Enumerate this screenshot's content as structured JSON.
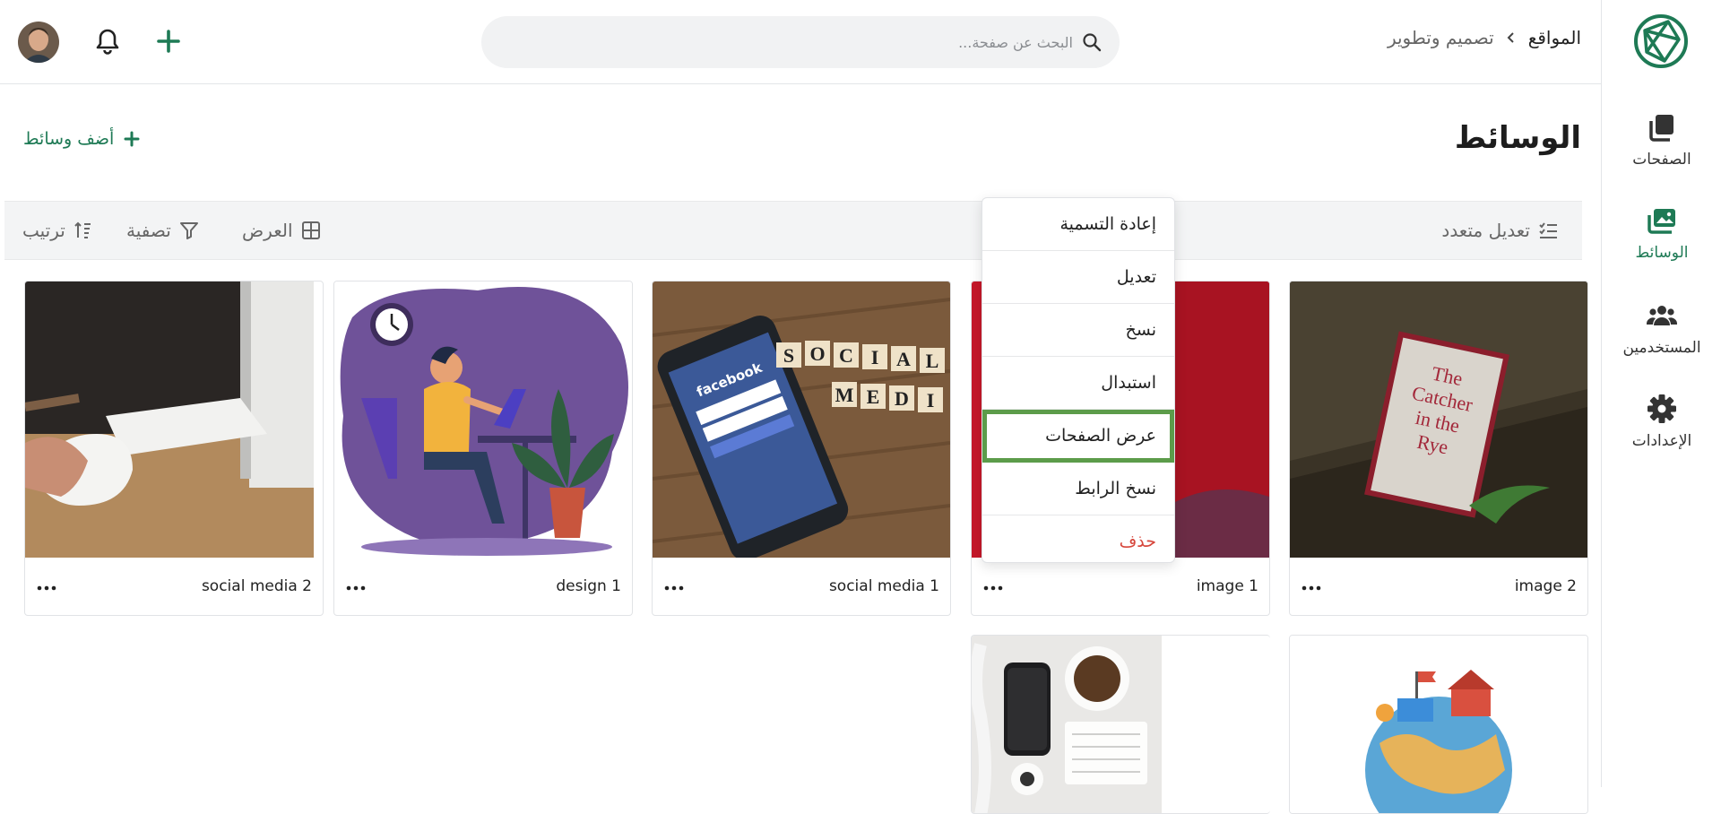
{
  "breadcrumb": {
    "root": "المواقع",
    "current": "تصميم وتطوير"
  },
  "search": {
    "placeholder": "البحث عن صفحة..."
  },
  "sidebar": {
    "items": [
      {
        "label": "الصفحات",
        "icon": "pages-icon"
      },
      {
        "label": "الوسائط",
        "icon": "media-icon",
        "active": true
      },
      {
        "label": "المستخدمين",
        "icon": "users-icon"
      },
      {
        "label": "الإعدادات",
        "icon": "gear-icon"
      }
    ]
  },
  "page": {
    "title": "الوسائط",
    "add_label": "أضف وسائط"
  },
  "toolbar": {
    "bulk_edit": "تعديل متعدد",
    "view": "العرض",
    "filter": "تصفية",
    "sort": "ترتيب"
  },
  "cards": [
    {
      "name": "image 2"
    },
    {
      "name": "image 1"
    },
    {
      "name": "social media 1"
    },
    {
      "name": "design 1"
    },
    {
      "name": "social media 2"
    }
  ],
  "context_menu": {
    "items": [
      {
        "label": "إعادة التسمية"
      },
      {
        "label": "تعديل"
      },
      {
        "label": "نسخ"
      },
      {
        "label": "استبدال"
      },
      {
        "label": "عرض الصفحات",
        "highlighted": true
      },
      {
        "label": "نسخ الرابط"
      },
      {
        "label": "حذف",
        "danger": true
      }
    ]
  },
  "colors": {
    "accent": "#1e7a55",
    "danger": "#d6463b",
    "highlight_border": "#5c9c4a"
  }
}
